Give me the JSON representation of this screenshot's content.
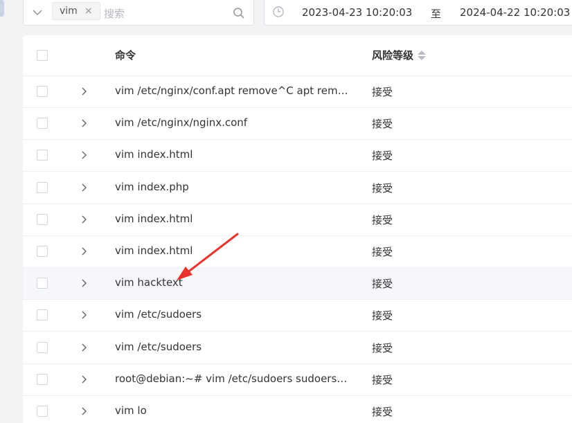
{
  "filter": {
    "tag_label": "vim",
    "search_placeholder": "搜索"
  },
  "date_range": {
    "start": "2023-04-23 10:20:03",
    "separator": "至",
    "end": "2024-04-22 10:20:03"
  },
  "table": {
    "columns": {
      "command": "命令",
      "risk": "风险等级"
    },
    "rows": [
      {
        "command": "vim /etc/nginx/conf.apt remove^C apt remove nginx",
        "risk": "接受"
      },
      {
        "command": "vim /etc/nginx/nginx.conf",
        "risk": "接受"
      },
      {
        "command": "vim index.html",
        "risk": "接受"
      },
      {
        "command": "vim index.php",
        "risk": "接受"
      },
      {
        "command": "vim index.html",
        "risk": "接受"
      },
      {
        "command": "vim index.html",
        "risk": "接受"
      },
      {
        "command": "vim hacktext",
        "risk": "接受"
      },
      {
        "command": "vim /etc/sudoers",
        "risk": "接受"
      },
      {
        "command": "vim /etc/sudoers",
        "risk": "接受"
      },
      {
        "command": "root@debian:~# vim /etc/sudoers sudoers sudoers",
        "risk": "接受"
      },
      {
        "command": "vim lo",
        "risk": "接受"
      }
    ]
  },
  "annotation": {
    "color": "#e8332b"
  },
  "icons": [
    "chevron-down-icon",
    "close-icon",
    "search-icon",
    "clock-icon",
    "sort-icon",
    "chevron-right-icon",
    "red-arrow-annotation"
  ]
}
